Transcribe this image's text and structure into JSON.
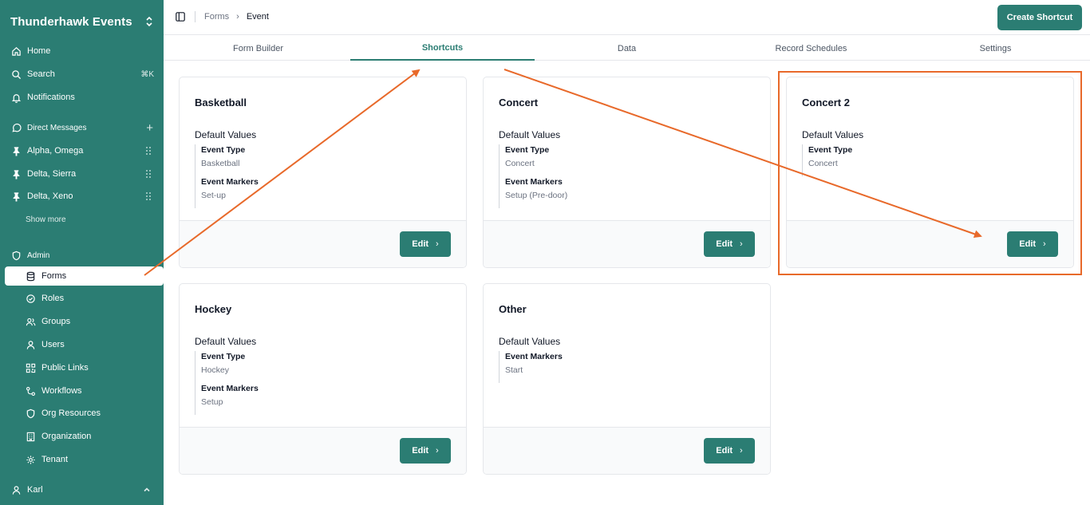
{
  "sidebar": {
    "workspace_name": "Thunderhawk Events",
    "nav": [
      {
        "label": "Home",
        "icon": "home-icon"
      },
      {
        "label": "Search",
        "icon": "search-icon",
        "shortcut": "⌘K"
      },
      {
        "label": "Notifications",
        "icon": "bell-icon"
      }
    ],
    "dm_section": {
      "label": "Direct Messages",
      "icon": "message-circle-icon",
      "add": "+"
    },
    "dms": [
      {
        "label": "Alpha, Omega"
      },
      {
        "label": "Delta, Sierra"
      },
      {
        "label": "Delta, Xeno"
      }
    ],
    "show_more": "Show more",
    "admin_section": {
      "label": "Admin",
      "icon": "shield-icon"
    },
    "admin_items": [
      {
        "label": "Forms",
        "icon": "database-icon",
        "active": true
      },
      {
        "label": "Roles",
        "icon": "check-circle-icon"
      },
      {
        "label": "Groups",
        "icon": "users-icon"
      },
      {
        "label": "Users",
        "icon": "user-icon"
      },
      {
        "label": "Public Links",
        "icon": "qr-code-icon"
      },
      {
        "label": "Workflows",
        "icon": "workflow-icon"
      },
      {
        "label": "Org Resources",
        "icon": "shield-icon"
      },
      {
        "label": "Organization",
        "icon": "building-icon"
      },
      {
        "label": "Tenant",
        "icon": "gear-icon"
      }
    ],
    "user": {
      "label": "Karl",
      "icon": "user-icon"
    }
  },
  "topbar": {
    "breadcrumb": [
      "Forms",
      "Event"
    ],
    "create_button": "Create Shortcut"
  },
  "tabs": [
    {
      "label": "Form Builder",
      "active": false
    },
    {
      "label": "Shortcuts",
      "active": true
    },
    {
      "label": "Data",
      "active": false
    },
    {
      "label": "Record Schedules",
      "active": false
    },
    {
      "label": "Settings",
      "active": false
    }
  ],
  "cards": [
    {
      "title": "Basketball",
      "default_label": "Default Values",
      "fields": [
        {
          "key": "Event Type",
          "value": "Basketball"
        },
        {
          "key": "Event Markers",
          "value": "Set-up"
        }
      ],
      "edit": "Edit"
    },
    {
      "title": "Concert",
      "default_label": "Default Values",
      "fields": [
        {
          "key": "Event Type",
          "value": "Concert"
        },
        {
          "key": "Event Markers",
          "value": "Setup (Pre-door)"
        }
      ],
      "edit": "Edit"
    },
    {
      "title": "Concert 2",
      "default_label": "Default Values",
      "fields": [
        {
          "key": "Event Type",
          "value": "Concert"
        }
      ],
      "edit": "Edit"
    },
    {
      "title": "Hockey",
      "default_label": "Default Values",
      "fields": [
        {
          "key": "Event Type",
          "value": "Hockey"
        },
        {
          "key": "Event Markers",
          "value": "Setup"
        }
      ],
      "edit": "Edit"
    },
    {
      "title": "Other",
      "default_label": "Default Values",
      "fields": [
        {
          "key": "Event Markers",
          "value": "Start"
        }
      ],
      "edit": "Edit"
    }
  ],
  "colors": {
    "brand": "#2b7d73",
    "annotation": "#e8692a"
  }
}
